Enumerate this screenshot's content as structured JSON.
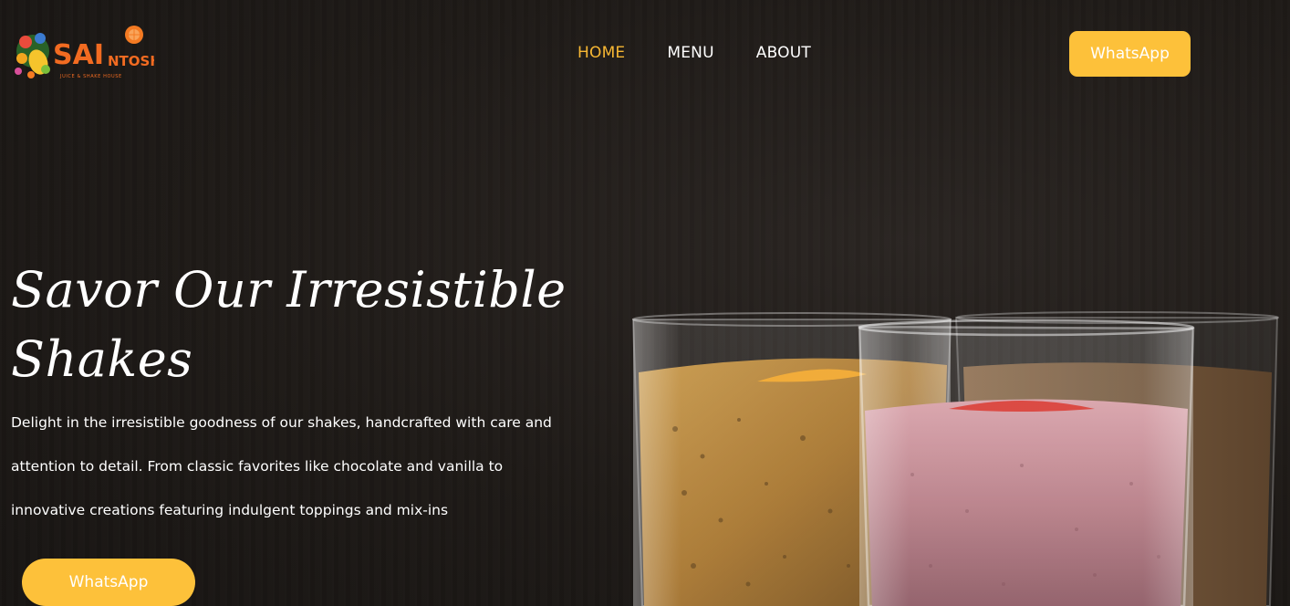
{
  "brand": {
    "logo_text_main": "SAI",
    "logo_text_sub": "NTOSH",
    "logo_tagline": "JUICE & SHAKE HOUSE"
  },
  "nav": {
    "items": [
      {
        "label": "HOME",
        "active": true
      },
      {
        "label": "MENU",
        "active": false
      },
      {
        "label": "ABOUT",
        "active": false
      }
    ]
  },
  "header": {
    "cta_label": "WhatsApp"
  },
  "hero": {
    "title_line1": "Savor Our Irresistible",
    "title_line2": "Shakes",
    "description": "Delight in the irresistible goodness of our shakes, handcrafted with care and attention to detail. From classic favorites like chocolate and vanilla to innovative creations featuring indulgent toppings and mix-ins",
    "cta_label": "WhatsApp"
  },
  "colors": {
    "accent": "#fdc13a",
    "nav_active": "#f7b733",
    "background": "#1f1b18",
    "text": "#ffffff"
  },
  "icons": {
    "logo": "juice-house-logo"
  }
}
